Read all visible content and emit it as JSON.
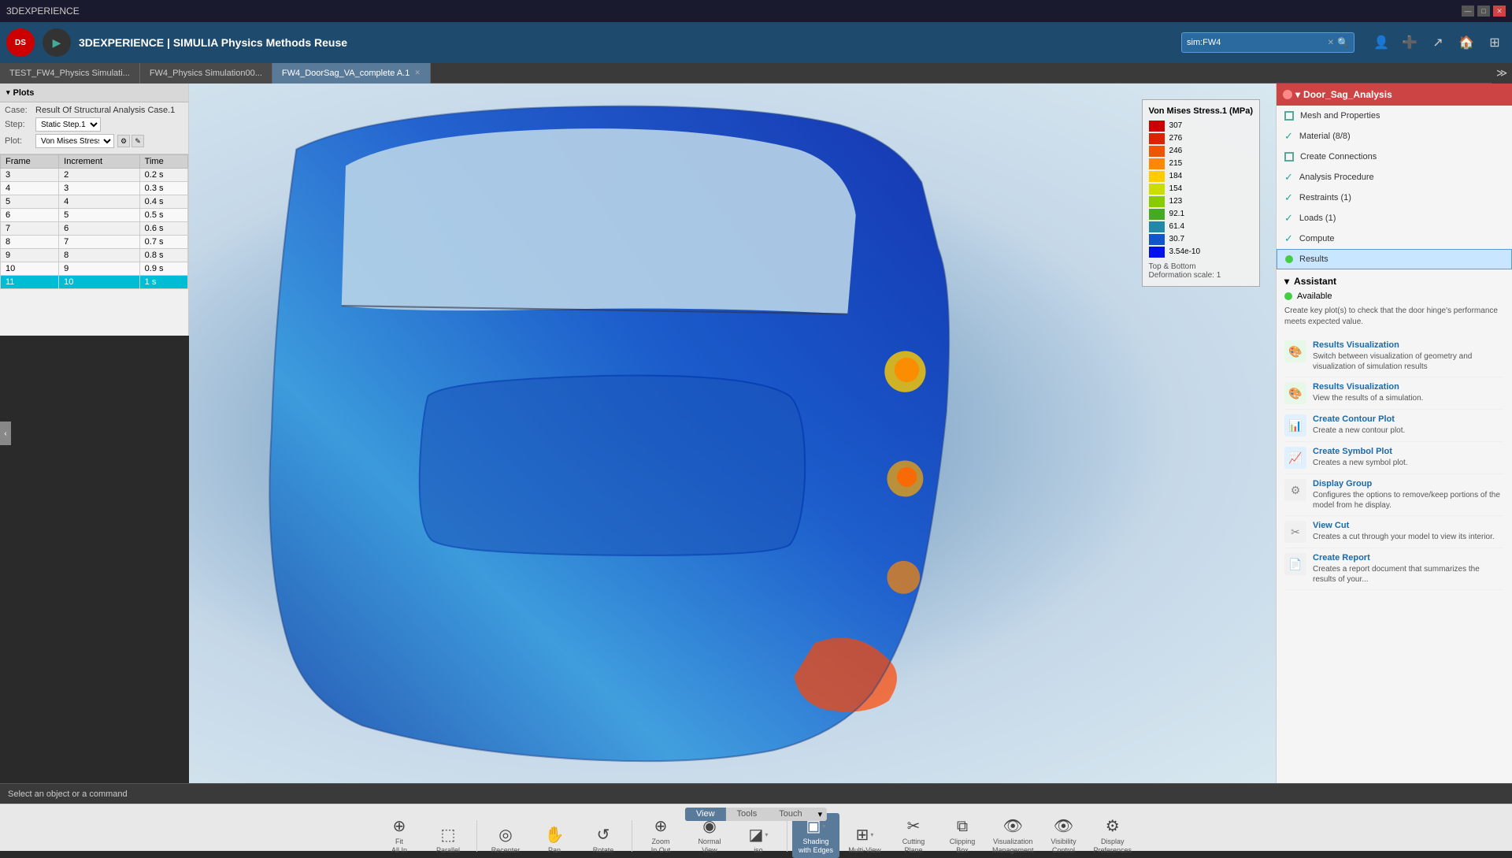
{
  "titlebar": {
    "title": "3DEXPERIENCE",
    "min_label": "—",
    "max_label": "□",
    "close_label": "✕"
  },
  "top_toolbar": {
    "app_title": "3DEXPERIENCE | SIMULIA Physics Methods Reuse",
    "search_placeholder": "sim:FW4",
    "search_value": "sim:FW4"
  },
  "tabs": [
    {
      "label": "TEST_FW4_Physics Simulati...",
      "active": false,
      "closable": false
    },
    {
      "label": "FW4_Physics Simulation00...",
      "active": false,
      "closable": false
    },
    {
      "label": "FW4_DoorSag_VA_complete A.1",
      "active": true,
      "closable": true
    }
  ],
  "plots_panel": {
    "title": "Plots",
    "case_label": "Case:",
    "case_value": "Result Of Structural Analysis Case.1",
    "step_label": "Step:",
    "step_value": "Static Step.1",
    "plot_label": "Plot:",
    "plot_value": "Von Mises Stress.1",
    "columns": [
      "Frame",
      "Increment",
      "Time"
    ],
    "rows": [
      {
        "frame": "3",
        "increment": "2",
        "time": "0.2 s",
        "selected": false
      },
      {
        "frame": "4",
        "increment": "3",
        "time": "0.3 s",
        "selected": false
      },
      {
        "frame": "5",
        "increment": "4",
        "time": "0.4 s",
        "selected": false
      },
      {
        "frame": "6",
        "increment": "5",
        "time": "0.5 s",
        "selected": false
      },
      {
        "frame": "7",
        "increment": "6",
        "time": "0.6 s",
        "selected": false
      },
      {
        "frame": "8",
        "increment": "7",
        "time": "0.7 s",
        "selected": false
      },
      {
        "frame": "9",
        "increment": "8",
        "time": "0.8 s",
        "selected": false
      },
      {
        "frame": "10",
        "increment": "9",
        "time": "0.9 s",
        "selected": false
      },
      {
        "frame": "11",
        "increment": "10",
        "time": "1 s",
        "selected": true
      }
    ]
  },
  "legend": {
    "title": "Von Mises Stress.1 (MPa)",
    "values": [
      "307",
      "276",
      "246",
      "215",
      "184",
      "154",
      "123",
      "92.1",
      "61.4",
      "30.7",
      "3.54e-10"
    ],
    "colors": [
      "#cc0000",
      "#dd2200",
      "#ee5500",
      "#ff8800",
      "#ffcc00",
      "#ccdd00",
      "#88cc00",
      "#44aa22",
      "#2288aa",
      "#1155cc",
      "#0011ee"
    ],
    "bottom_label": "Top & Bottom",
    "deform_label": "Deformation scale: 1"
  },
  "right_panel": {
    "header": "Door_Sag_Analysis",
    "items": [
      {
        "type": "square",
        "label": "Mesh and Properties",
        "active": false
      },
      {
        "type": "check",
        "label": "Material (8/8)",
        "active": false
      },
      {
        "type": "square",
        "label": "Create Connections",
        "active": false
      },
      {
        "type": "check",
        "label": "Analysis Procedure",
        "active": false
      },
      {
        "type": "check",
        "label": "Restraints (1)",
        "active": false
      },
      {
        "type": "check",
        "label": "Loads (1)",
        "active": false
      },
      {
        "type": "check",
        "label": "Compute",
        "active": false
      },
      {
        "type": "dot",
        "label": "Results",
        "active": true,
        "highlighted": true
      }
    ],
    "assistant": {
      "label": "Assistant",
      "available_label": "Available",
      "description": "Create key plot(s) to check that the door hinge's performance meets expected value.",
      "items": [
        {
          "icon": "🎨",
          "icon_type": "green",
          "title": "Results Visualization",
          "description": "Switch between visualization of geometry and visualization of simulation results"
        },
        {
          "icon": "🎨",
          "icon_type": "green",
          "title": "Results Visualization",
          "description": "View the results of a simulation."
        },
        {
          "icon": "📊",
          "icon_type": "blue",
          "title": "Create Contour Plot",
          "description": "Create a new contour plot."
        },
        {
          "icon": "📈",
          "icon_type": "blue",
          "title": "Create Symbol Plot",
          "description": "Creates a new symbol plot."
        },
        {
          "icon": "⚙",
          "icon_type": "gray",
          "title": "Display Group",
          "description": "Configures the options to remove/keep portions of the model from he display."
        },
        {
          "icon": "✂",
          "icon_type": "gray",
          "title": "View Cut",
          "description": "Creates a cut through your model to view its interior."
        },
        {
          "icon": "📄",
          "icon_type": "gray",
          "title": "Create Report",
          "description": "Creates a report document that summarizes the results of your..."
        }
      ]
    }
  },
  "bottom_toolbar": {
    "view_tabs": [
      "View",
      "Tools",
      "Touch"
    ],
    "active_view_tab": "View",
    "buttons": [
      {
        "icon": "⊕",
        "label": "Fit\nAll In",
        "name": "fit-all-in",
        "active": false,
        "has_dropdown": false
      },
      {
        "icon": "▱",
        "label": "Parallel",
        "name": "parallel",
        "active": false,
        "has_dropdown": false
      },
      {
        "icon": "⊕",
        "label": "Recenter",
        "name": "recenter",
        "active": false,
        "has_dropdown": false
      },
      {
        "icon": "✋",
        "label": "Pan",
        "name": "pan",
        "active": false,
        "has_dropdown": false
      },
      {
        "icon": "↻",
        "label": "Rotate",
        "name": "rotate",
        "active": false,
        "has_dropdown": false
      },
      {
        "icon": "⊕",
        "label": "Zoom\nIn Out",
        "name": "zoom-in-out",
        "active": false,
        "has_dropdown": false
      },
      {
        "icon": "👁",
        "label": "Normal\nView",
        "name": "normal-view",
        "active": false,
        "has_dropdown": false
      },
      {
        "icon": "◪",
        "label": "iso",
        "name": "iso",
        "active": false,
        "has_dropdown": true
      },
      {
        "icon": "◼",
        "label": "Shading\nwith Edges",
        "name": "shading-with-edges",
        "active": true,
        "has_dropdown": true
      },
      {
        "icon": "⊞",
        "label": "Multi-View",
        "name": "multi-view",
        "active": false,
        "has_dropdown": true
      },
      {
        "icon": "✂",
        "label": "Cutting\nPlane",
        "name": "cutting-plane",
        "active": false,
        "has_dropdown": false
      },
      {
        "icon": "⧉",
        "label": "Clipping\nBox",
        "name": "clipping-box",
        "active": false,
        "has_dropdown": false
      },
      {
        "icon": "👁",
        "label": "Visualization\nManagement",
        "name": "visualization-management",
        "active": false,
        "has_dropdown": false
      },
      {
        "icon": "👁",
        "label": "Visibility\nControl",
        "name": "visibility-control",
        "active": false,
        "has_dropdown": false
      },
      {
        "icon": "⚙",
        "label": "Display\nPreferences",
        "name": "display-preferences",
        "active": false,
        "has_dropdown": false
      }
    ]
  },
  "status_bar": {
    "message": "Select an object or a command"
  }
}
